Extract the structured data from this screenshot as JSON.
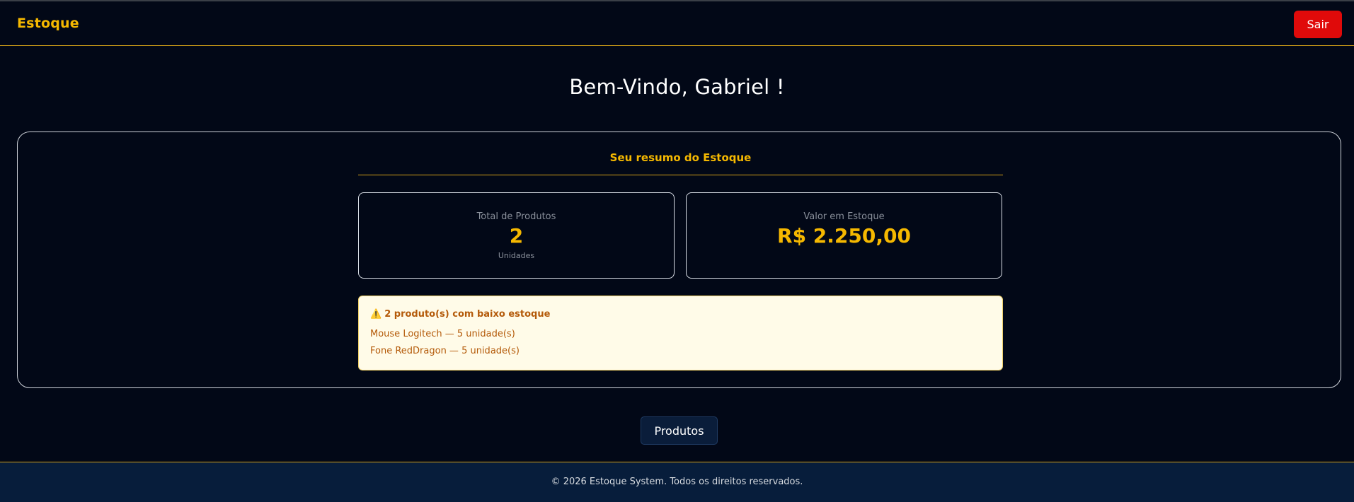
{
  "header": {
    "brand": "Estoque",
    "logout_label": "Sair"
  },
  "main": {
    "welcome": "Bem-Vindo, Gabriel !",
    "summary": {
      "title": "Seu resumo do Estoque",
      "cards": [
        {
          "label": "Total de Produtos",
          "value": "2",
          "subtext": "Unidades"
        },
        {
          "label": "Valor em Estoque",
          "value": "R$ 2.250,00"
        }
      ],
      "alert": {
        "icon": "⚠️",
        "title": "2 produto(s) com baixo estoque",
        "items": [
          "Mouse Logitech — 5 unidade(s)",
          "Fone RedDragon — 5 unidade(s)"
        ]
      }
    },
    "products_button_label": "Produtos"
  },
  "footer": {
    "text": "© 2026 Estoque System. Todos os direitos reservados."
  },
  "colors": {
    "background": "#020817",
    "accent": "#f5b800",
    "danger": "#e00a0a",
    "footer": "#071d3b",
    "alert_background": "#fffbe8",
    "alert_text": "#b45a09"
  }
}
